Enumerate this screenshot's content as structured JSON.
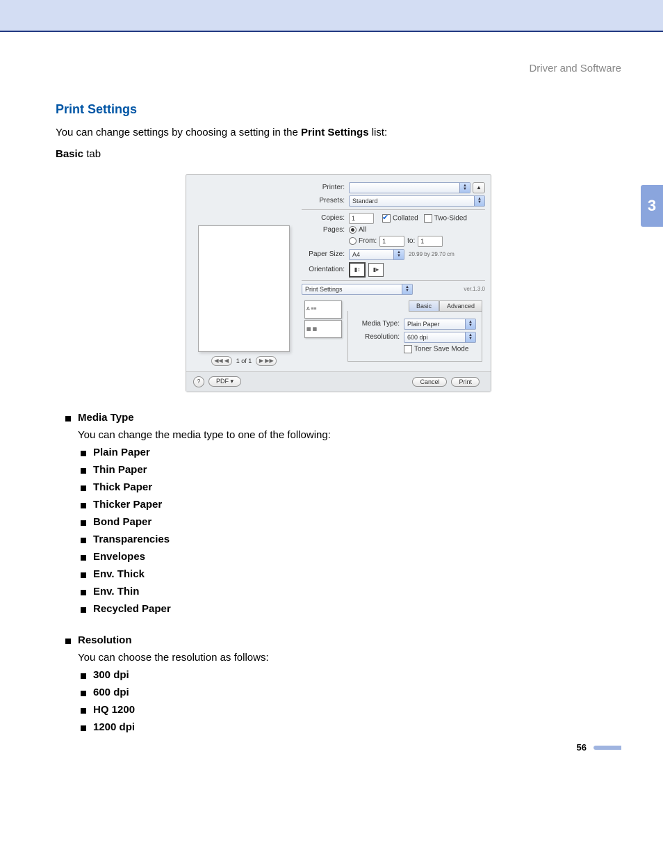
{
  "breadcrumb": "Driver and Software",
  "page_number": "56",
  "side_tab": "3",
  "title": "Print Settings",
  "intro_before": "You can change settings by choosing a setting in the ",
  "intro_bold": "Print Settings",
  "intro_after": " list:",
  "sub_intro_bold": "Basic",
  "sub_intro_after": " tab",
  "dialog": {
    "preview": {
      "nav_prev": "◀◀ ◀",
      "nav_label": "1 of 1",
      "nav_next": "▶ ▶▶"
    },
    "printer_label": "Printer:",
    "printer_value": "",
    "presets_label": "Presets:",
    "presets_value": "Standard",
    "copies_label": "Copies:",
    "copies_value": "1",
    "collated_label": "Collated",
    "two_sided_label": "Two-Sided",
    "pages_label": "Pages:",
    "pages_all": "All",
    "pages_from": "From:",
    "pages_from_value": "1",
    "pages_to": "to:",
    "pages_to_value": "1",
    "paper_size_label": "Paper Size:",
    "paper_size_value": "A4",
    "paper_size_dim": "20.99 by 29.70 cm",
    "orientation_label": "Orientation:",
    "print_settings_label": "Print Settings",
    "ver": "ver.1.3.0",
    "tab_basic": "Basic",
    "tab_advanced": "Advanced",
    "media_type_label": "Media Type:",
    "media_type_value": "Plain Paper",
    "resolution_label": "Resolution:",
    "resolution_value": "600 dpi",
    "toner_save_label": "Toner Save Mode",
    "help": "?",
    "pdf": "PDF ▾",
    "cancel": "Cancel",
    "print": "Print"
  },
  "media_type": {
    "heading": "Media Type",
    "desc": "You can change the media type to one of the following:",
    "items": [
      "Plain Paper",
      "Thin Paper",
      "Thick Paper",
      "Thicker Paper",
      "Bond Paper",
      "Transparencies",
      "Envelopes",
      "Env. Thick",
      "Env. Thin",
      "Recycled Paper"
    ]
  },
  "resolution": {
    "heading": "Resolution",
    "desc": "You can choose the resolution as follows:",
    "items": [
      "300 dpi",
      "600 dpi",
      "HQ 1200",
      "1200 dpi"
    ]
  }
}
